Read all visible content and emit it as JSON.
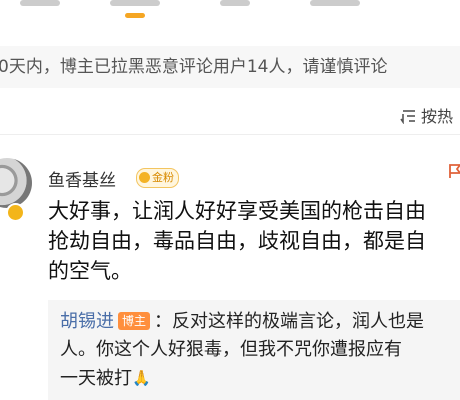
{
  "notice": {
    "text": "0天内，博主已拉黑恶意评论用户14人，请谨慎评论"
  },
  "sort": {
    "label": "按热"
  },
  "comment": {
    "username": "鱼香基丝",
    "fan_badge": "金粉",
    "lines": [
      "大好事，让润人好好享受美国的枪击自由",
      "抢劫自由，毒品自由，歧视自由，都是自",
      "的空气。"
    ]
  },
  "reply": {
    "author": "胡锡进",
    "badge": "博主",
    "line1": "：反对这样的极端言论，润人也是",
    "line2": "人。你这个人好狠毒，但我不咒你遭报应有",
    "line3": "一天被打",
    "emoji": "🙏"
  },
  "colors": {
    "accent": "#f5a623",
    "reply_author": "#4a6ea8",
    "blogger_badge": "#ff8f3d"
  }
}
